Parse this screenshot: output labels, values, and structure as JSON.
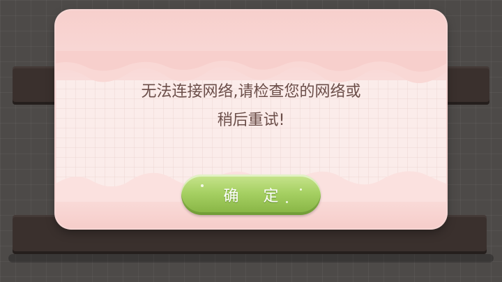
{
  "dialog": {
    "message_line1": "无法连接网络,请检查您的网络或",
    "message_line2": "稍后重试!",
    "confirm_label": "确 定"
  },
  "colors": {
    "backdrop": "#4d4a48",
    "shelf": "#3a302d",
    "dialog_bg": "#fbecea",
    "text": "#6b4e49",
    "button": "#a6d063"
  }
}
